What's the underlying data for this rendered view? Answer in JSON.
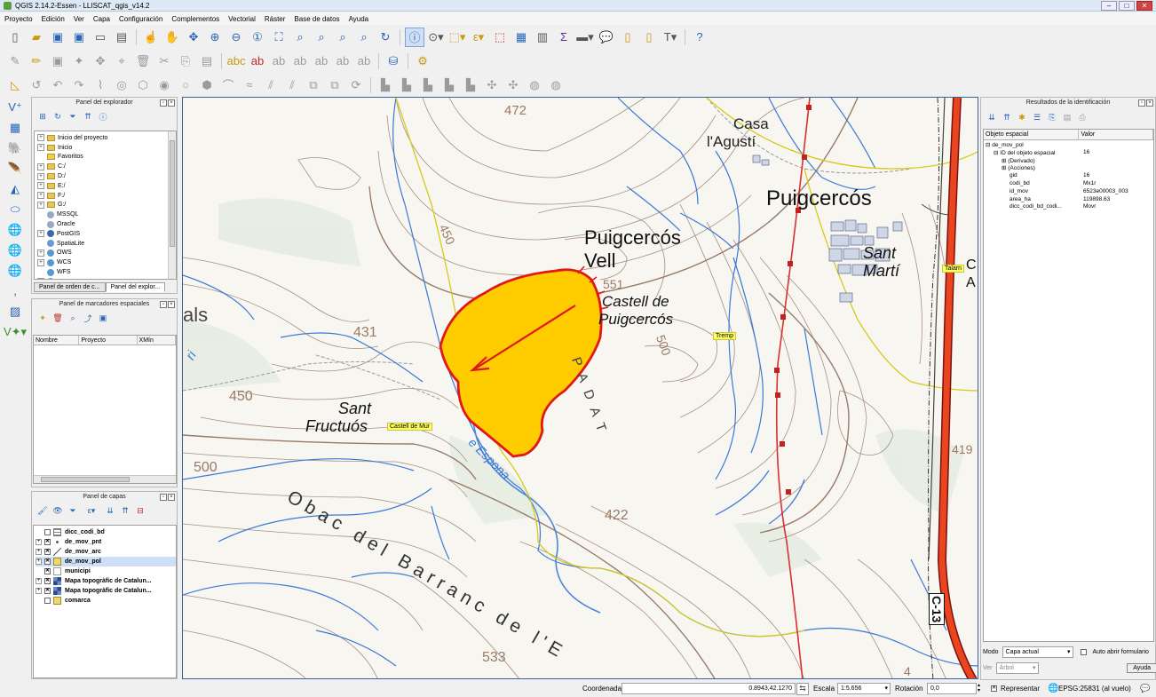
{
  "window": {
    "title": "QGIS 2.14.2-Essen - LLISCAT_qgis_v14.2"
  },
  "menu": [
    "Proyecto",
    "Edición",
    "Ver",
    "Capa",
    "Configuración",
    "Complementos",
    "Vectorial",
    "Ráster",
    "Base de datos",
    "Ayuda"
  ],
  "browser": {
    "title": "Panel del explorador",
    "items": [
      {
        "label": "Inicio del proyecto",
        "expandable": true,
        "kind": "folder"
      },
      {
        "label": "Inicio",
        "expandable": true,
        "kind": "folder"
      },
      {
        "label": "Favoritos",
        "expandable": false,
        "kind": "star"
      },
      {
        "label": "C:/",
        "expandable": true,
        "kind": "folder"
      },
      {
        "label": "D:/",
        "expandable": true,
        "kind": "folder"
      },
      {
        "label": "E:/",
        "expandable": true,
        "kind": "folder"
      },
      {
        "label": "F:/",
        "expandable": true,
        "kind": "folder"
      },
      {
        "label": "G:/",
        "expandable": true,
        "kind": "folder"
      },
      {
        "label": "MSSQL",
        "expandable": false,
        "kind": "db"
      },
      {
        "label": "Oracle",
        "expandable": false,
        "kind": "db"
      },
      {
        "label": "PostGIS",
        "expandable": true,
        "kind": "db"
      },
      {
        "label": "SpatiaLite",
        "expandable": false,
        "kind": "db"
      },
      {
        "label": "OWS",
        "expandable": true,
        "kind": "web"
      },
      {
        "label": "WCS",
        "expandable": true,
        "kind": "web"
      },
      {
        "label": "WFS",
        "expandable": false,
        "kind": "web"
      },
      {
        "label": "WMS",
        "expandable": true,
        "kind": "web"
      }
    ],
    "tabs": [
      "Panel de orden de c...",
      "Panel del explor..."
    ]
  },
  "bookmarks": {
    "title": "Panel de marcadores espaciales",
    "columns": [
      "Nombre",
      "Proyecto",
      "XMín"
    ]
  },
  "layers": {
    "title": "Panel de capas",
    "items": [
      {
        "label": "dicc_codi_bd",
        "checked": false,
        "expandable": false,
        "icon": "table-icon"
      },
      {
        "label": "de_mov_pnt",
        "checked": true,
        "expandable": true,
        "icon": "point-layer-icon"
      },
      {
        "label": "de_mov_arc",
        "checked": true,
        "expandable": true,
        "icon": "line-layer-icon"
      },
      {
        "label": "de_mov_pol",
        "checked": true,
        "expandable": true,
        "icon": "polygon-layer-icon",
        "selected": true
      },
      {
        "label": "municipi",
        "checked": true,
        "expandable": false,
        "icon": "vector-layer-icon"
      },
      {
        "label": "Mapa topogràfic de Catalun...",
        "checked": true,
        "expandable": true,
        "icon": "raster-layer-icon"
      },
      {
        "label": "Mapa topogràfic de Catalun...",
        "checked": true,
        "expandable": true,
        "icon": "raster-layer-icon"
      },
      {
        "label": "comarca",
        "checked": false,
        "expandable": false,
        "icon": "polygon-layer-icon"
      }
    ]
  },
  "identify": {
    "title": "Resultados de la identificación",
    "columns": [
      "Objeto espacial",
      "Valor"
    ],
    "rows": [
      {
        "key": "de_mov_pol",
        "value": "",
        "indent": 0,
        "expander": "⊟"
      },
      {
        "key": "ID del objeto espacial",
        "value": "16",
        "indent": 1,
        "expander": "⊟"
      },
      {
        "key": "(Derivado)",
        "value": "",
        "indent": 2,
        "expander": "⊞"
      },
      {
        "key": "(Acciones)",
        "value": "",
        "indent": 2,
        "expander": "⊞"
      },
      {
        "key": "gid",
        "value": "16",
        "indent": 3,
        "expander": ""
      },
      {
        "key": "codi_bd",
        "value": "Mx1r",
        "indent": 3,
        "expander": ""
      },
      {
        "key": "id_mov",
        "value": "6523e00003_003",
        "indent": 3,
        "expander": ""
      },
      {
        "key": "area_ha",
        "value": "119898.63",
        "indent": 3,
        "expander": ""
      },
      {
        "key": "dicc_codi_bd_codi...",
        "value": "Movr",
        "indent": 3,
        "expander": ""
      }
    ],
    "mode_label": "Modo",
    "mode_value": "Capa actual",
    "auto_open_label": "Auto abrir formulario",
    "view_label": "Ver",
    "view_value": "Árbol",
    "help_label": "Ayuda"
  },
  "map": {
    "labels": {
      "casa1": "Casa",
      "casa2": "l'Agustí",
      "puigcercos": "Puigcercós",
      "pvell1": "Puigcercós",
      "pvell2": "Vell",
      "castell1": "Castell de",
      "castell2": "Puigcercós",
      "santmarti1": "Sant",
      "santmarti2": "Martí",
      "santfructuos1": "Sant",
      "santfructuos2": "Fructuós",
      "obac": "Obac del Barranc de l'E",
      "padat": "PADAT",
      "esponal": "e Espona",
      "als": "als",
      "riu": "ri",
      "road": "C-13",
      "c_frag": "C",
      "a_frag": "A"
    },
    "contours": {
      "e472": "472",
      "e450a": "450",
      "e551": "551",
      "e500a": "500",
      "e431": "431",
      "e450b": "450",
      "e500b": "500",
      "e422": "422",
      "e533": "533",
      "e419": "419",
      "e4": "4"
    },
    "tags": {
      "tremp": "Tremp",
      "castelldemur": "Castell de Mur",
      "talarn": "Talarn"
    }
  },
  "status": {
    "coord_label": "Coordenada",
    "coord_value": "0.8943,42.1270",
    "scale_label": "Escala",
    "scale_value": "1:5.656",
    "rotation_label": "Rotación",
    "rotation_value": "0,0",
    "render_label": "Representar",
    "crs": "EPSG:25831 (al vuelo)"
  },
  "colors": {
    "polygon_fill": "#ffcc00",
    "polygon_stroke": "#e01818",
    "water": "#3a78d8",
    "contour": "#a88e7c",
    "rail": "#d83030"
  }
}
